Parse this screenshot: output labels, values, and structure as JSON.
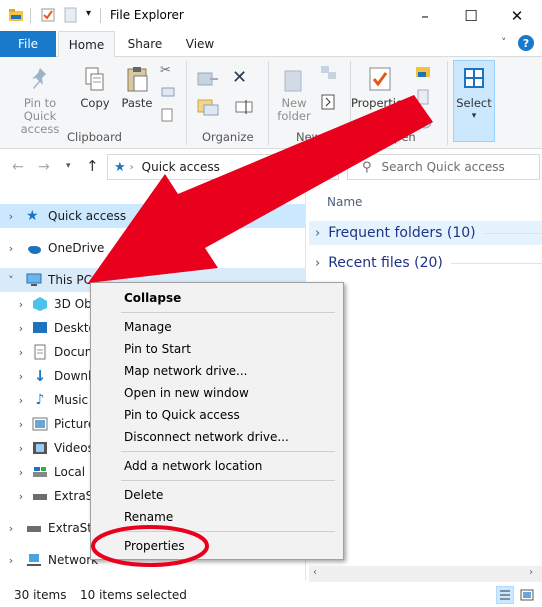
{
  "window": {
    "title": "File Explorer",
    "minimize": "–",
    "maximize": "☐",
    "close": "✕"
  },
  "tabs": {
    "file": "File",
    "home": "Home",
    "share": "Share",
    "view": "View"
  },
  "ribbon": {
    "pin_quick_access": "Pin to Quick access",
    "copy": "Copy",
    "paste": "Paste",
    "clipboard_group": "Clipboard",
    "organize_group": "Organize",
    "new_folder": "New folder",
    "new_group": "New",
    "properties": "Properties",
    "open_group": "Open",
    "select": "Select"
  },
  "address": {
    "path": "Quick access",
    "search_placeholder": "Search Quick access"
  },
  "nav": {
    "items": [
      {
        "label": "Quick access"
      },
      {
        "label": "OneDrive"
      },
      {
        "label": "This PC"
      },
      {
        "label": "3D Obj"
      },
      {
        "label": "Deskto"
      },
      {
        "label": "Docum"
      },
      {
        "label": "Downl"
      },
      {
        "label": "Music"
      },
      {
        "label": "Picture"
      },
      {
        "label": "Videos"
      },
      {
        "label": "Local D"
      },
      {
        "label": "ExtraSt"
      },
      {
        "label": "ExtraStor"
      },
      {
        "label": "Network"
      }
    ]
  },
  "content": {
    "name_header": "Name",
    "frequent": "Frequent folders (10)",
    "recent": "Recent files (20)"
  },
  "context_menu": {
    "items": [
      "Collapse",
      "Manage",
      "Pin to Start",
      "Map network drive...",
      "Open in new window",
      "Pin to Quick access",
      "Disconnect network drive...",
      "Add a network location",
      "Delete",
      "Rename",
      "Properties"
    ]
  },
  "status": {
    "count": "30 items",
    "selected": "10 items selected"
  },
  "colors": {
    "accent": "#1979ca",
    "annotation": "#e8001c"
  }
}
